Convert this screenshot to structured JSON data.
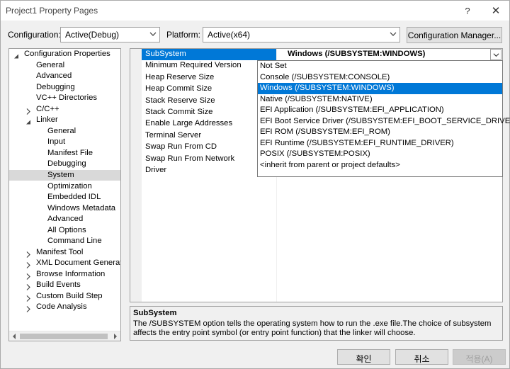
{
  "window": {
    "title": "Project1 Property Pages",
    "help_glyph": "?",
    "close_glyph": "✕"
  },
  "toolbar": {
    "configuration_label": "Configuration:",
    "configuration_value": "Active(Debug)",
    "platform_label": "Platform:",
    "platform_value": "Active(x64)",
    "configuration_manager_label": "Configuration Manager..."
  },
  "tree": {
    "items": [
      {
        "label": "Configuration Properties",
        "expander": "expanded"
      },
      {
        "label": "General"
      },
      {
        "label": "Advanced"
      },
      {
        "label": "Debugging"
      },
      {
        "label": "VC++ Directories"
      },
      {
        "label": "C/C++",
        "expander": "collapsed"
      },
      {
        "label": "Linker",
        "expander": "expanded"
      },
      {
        "label": "General"
      },
      {
        "label": "Input"
      },
      {
        "label": "Manifest File"
      },
      {
        "label": "Debugging"
      },
      {
        "label": "System",
        "selected": true
      },
      {
        "label": "Optimization"
      },
      {
        "label": "Embedded IDL"
      },
      {
        "label": "Windows Metadata"
      },
      {
        "label": "Advanced"
      },
      {
        "label": "All Options"
      },
      {
        "label": "Command Line"
      },
      {
        "label": "Manifest Tool",
        "expander": "collapsed"
      },
      {
        "label": "XML Document Generator",
        "expander": "collapsed"
      },
      {
        "label": "Browse Information",
        "expander": "collapsed"
      },
      {
        "label": "Build Events",
        "expander": "collapsed"
      },
      {
        "label": "Custom Build Step",
        "expander": "collapsed"
      },
      {
        "label": "Code Analysis",
        "expander": "collapsed"
      }
    ]
  },
  "grid": {
    "rows": [
      {
        "name": "SubSystem",
        "value": "Windows (/SUBSYSTEM:WINDOWS)",
        "selected": true
      },
      {
        "name": "Minimum Required Version",
        "value": ""
      },
      {
        "name": "Heap Reserve Size",
        "value": ""
      },
      {
        "name": "Heap Commit Size",
        "value": ""
      },
      {
        "name": "Stack Reserve Size",
        "value": ""
      },
      {
        "name": "Stack Commit Size",
        "value": ""
      },
      {
        "name": "Enable Large Addresses",
        "value": ""
      },
      {
        "name": "Terminal Server",
        "value": ""
      },
      {
        "name": "Swap Run From CD",
        "value": ""
      },
      {
        "name": "Swap Run From Network",
        "value": ""
      },
      {
        "name": "Driver",
        "value": ""
      }
    ]
  },
  "dropdown": {
    "options": [
      {
        "label": "Not Set"
      },
      {
        "label": "Console (/SUBSYSTEM:CONSOLE)"
      },
      {
        "label": "Windows (/SUBSYSTEM:WINDOWS)",
        "selected": true
      },
      {
        "label": "Native (/SUBSYSTEM:NATIVE)"
      },
      {
        "label": "EFI Application (/SUBSYSTEM:EFI_APPLICATION)"
      },
      {
        "label": "EFI Boot Service Driver (/SUBSYSTEM:EFI_BOOT_SERVICE_DRIVER)"
      },
      {
        "label": "EFI ROM (/SUBSYSTEM:EFI_ROM)"
      },
      {
        "label": "EFI Runtime (/SUBSYSTEM:EFI_RUNTIME_DRIVER)"
      },
      {
        "label": "POSIX (/SUBSYSTEM:POSIX)"
      },
      {
        "label": "<inherit from parent or project defaults>"
      }
    ]
  },
  "description": {
    "title": "SubSystem",
    "text": "The /SUBSYSTEM option tells the operating system how to run the .exe file.The choice of subsystem affects the entry point symbol (or entry point function) that the linker will choose."
  },
  "buttons": {
    "ok": "확인",
    "cancel": "취소",
    "apply": "적용(A)"
  },
  "colors": {
    "accent": "#0078d7",
    "tree_selection": "#d9d9d9"
  }
}
